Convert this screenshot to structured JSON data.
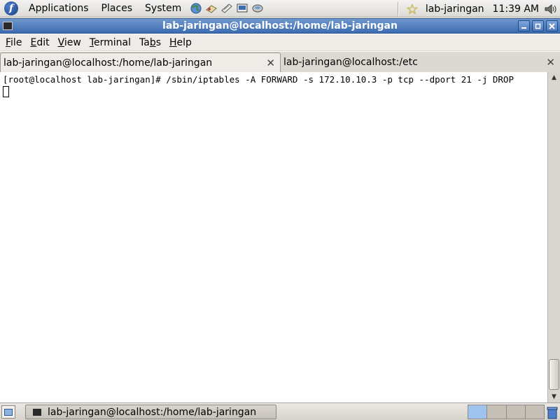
{
  "top_panel": {
    "menus": [
      "Applications",
      "Places",
      "System"
    ],
    "launchers": [
      "web-browser-icon",
      "mail-icon",
      "notes-icon",
      "presentation-icon",
      "network-icon"
    ],
    "username": "lab-jaringan",
    "clock": "11:39 AM"
  },
  "window": {
    "title": "lab-jaringan@localhost:/home/lab-jaringan",
    "buttons": [
      "minimize-button",
      "maximize-button",
      "close-button"
    ]
  },
  "menubar": {
    "items": [
      {
        "pre": "",
        "ul": "F",
        "post": "ile"
      },
      {
        "pre": "",
        "ul": "E",
        "post": "dit"
      },
      {
        "pre": "",
        "ul": "V",
        "post": "iew"
      },
      {
        "pre": "",
        "ul": "T",
        "post": "erminal"
      },
      {
        "pre": "Ta",
        "ul": "b",
        "post": "s"
      },
      {
        "pre": "",
        "ul": "H",
        "post": "elp"
      }
    ]
  },
  "tabs": [
    {
      "label": "lab-jaringan@localhost:/home/lab-jaringan",
      "active": true
    },
    {
      "label": "lab-jaringan@localhost:/etc",
      "active": false
    }
  ],
  "terminal": {
    "lines": [
      "[root@localhost lab-jaringan]# /sbin/iptables -A FORWARD -s 172.10.10.3 -p tcp --dport 21 -j DROP"
    ]
  },
  "taskbar": {
    "window_label": "lab-jaringan@localhost:/home/lab-jaringan",
    "workspaces": 4,
    "active_workspace": 1
  },
  "colors": {
    "titlebar": "#3b6bb1",
    "panel": "#dcdad5",
    "terminal_bg": "#ffffff"
  }
}
